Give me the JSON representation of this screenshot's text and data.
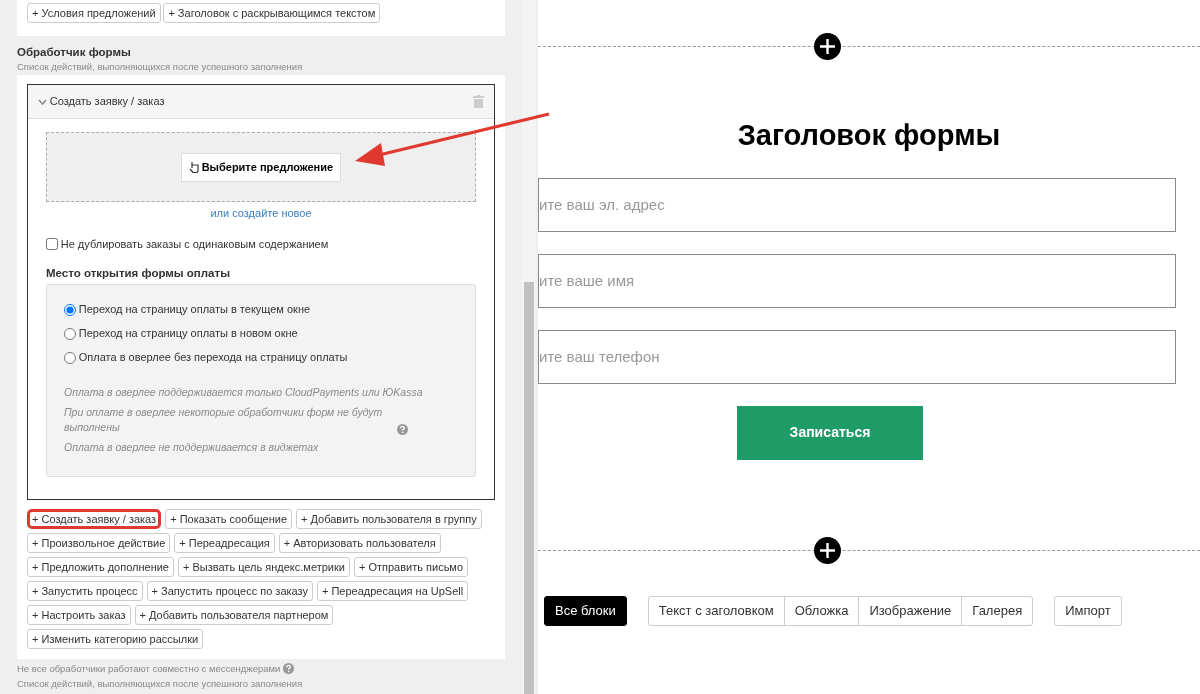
{
  "top_buttons": [
    {
      "label": "+ Условия предложений"
    },
    {
      "label": "+ Заголовок с раскрывающимся текстом"
    }
  ],
  "handler": {
    "title": "Обработчик формы",
    "subtitle": "Список действий, выполняющихся после успешного заполнения",
    "action": {
      "title": "Создать заявку / заказ",
      "expanded": true,
      "offer_button": "Выберите предложение",
      "create_link": "или создайте новое",
      "no_duplicates": {
        "label": "Не дублировать заказы с одинаковым содержанием",
        "checked": false
      },
      "payment_title": "Место открытия формы оплаты",
      "payment_options": [
        {
          "label": "Переход на страницу оплаты в текущем окне",
          "selected": true
        },
        {
          "label": "Переход на страницу оплаты в новом окне",
          "selected": false
        },
        {
          "label": "Оплата в оверлее без перехода на страницу оплаты",
          "selected": false
        }
      ],
      "notes": [
        {
          "text": "Оплата в оверлее поддерживается только CloudPayments или ЮKassa",
          "help": false
        },
        {
          "text": "При оплате в оверлее некоторые обработчики форм не будут выполнены",
          "help": true
        },
        {
          "text": "Оплата в оверлее не поддерживается в виджетах",
          "help": false
        }
      ]
    },
    "add_buttons": [
      {
        "label": "+ Создать заявку / заказ",
        "highlighted": true
      },
      {
        "label": "+ Показать сообщение",
        "highlighted": false
      },
      {
        "label": "+ Добавить пользователя в группу",
        "highlighted": false
      },
      {
        "label": "+ Произвольное действие",
        "highlighted": false
      },
      {
        "label": "+ Переадресация",
        "highlighted": false
      },
      {
        "label": "+ Авторизовать пользователя",
        "highlighted": false
      },
      {
        "label": "+ Предложить дополнение",
        "highlighted": false
      },
      {
        "label": "+ Вызвать цель яндекс.метрики",
        "highlighted": false
      },
      {
        "label": "+ Отправить письмо",
        "highlighted": false
      },
      {
        "label": "+ Запустить процесс",
        "highlighted": false
      },
      {
        "label": "+ Запустить процесс по заказу",
        "highlighted": false
      },
      {
        "label": "+ Переадресация на UpSell",
        "highlighted": false
      },
      {
        "label": "+ Настроить заказ",
        "highlighted": false
      },
      {
        "label": "+ Добавить пользователя партнером",
        "highlighted": false
      },
      {
        "label": "+ Изменить категорию рассылки",
        "highlighted": false
      }
    ],
    "footer_notes": [
      {
        "text": "Не все обработчики работают совместно с мессенджерами",
        "help": true
      },
      {
        "text": "Список действий, выполняющихся после успешного заполнения",
        "help": false
      }
    ]
  },
  "preview": {
    "form_title": "Заголовок формы",
    "fields": [
      {
        "placeholder": "ите ваш эл. адрес"
      },
      {
        "placeholder": "ите ваше имя"
      },
      {
        "placeholder": "ите ваш телефон"
      }
    ],
    "submit": "Записаться",
    "block_tabs": [
      {
        "label": "Все блоки",
        "selected": true,
        "kind": "main"
      },
      {
        "label": "Текст с заголовком",
        "selected": false,
        "kind": "category"
      },
      {
        "label": "Обложка",
        "selected": false,
        "kind": "category"
      },
      {
        "label": "Изображение",
        "selected": false,
        "kind": "category"
      },
      {
        "label": "Галерея",
        "selected": false,
        "kind": "category"
      },
      {
        "label": "Импорт",
        "selected": false,
        "kind": "import"
      }
    ]
  }
}
